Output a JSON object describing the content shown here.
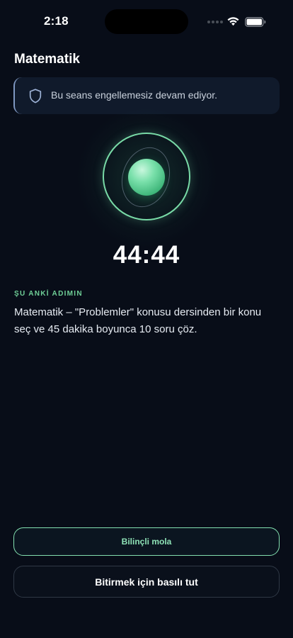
{
  "status_bar": {
    "time": "2:18"
  },
  "page": {
    "title": "Matematik"
  },
  "banner": {
    "text": "Bu seans engellemesiz devam ediyor."
  },
  "timer": {
    "value": "44:44"
  },
  "current_step": {
    "label": "ŞU ANKİ ADIMIN",
    "text": "Matematik – \"Problemler\" konusu dersinden bir konu seç ve 45 dakika boyunca 10 soru çöz."
  },
  "buttons": {
    "mindful_break": "Bilinçli mola",
    "hold_to_finish": "Bitirmek için basılı tut"
  },
  "colors": {
    "background": "#080d18",
    "accent_green": "#79dba7",
    "banner_bg": "#101a2b"
  },
  "icons": [
    "wifi-icon",
    "battery-icon",
    "shield-icon"
  ]
}
